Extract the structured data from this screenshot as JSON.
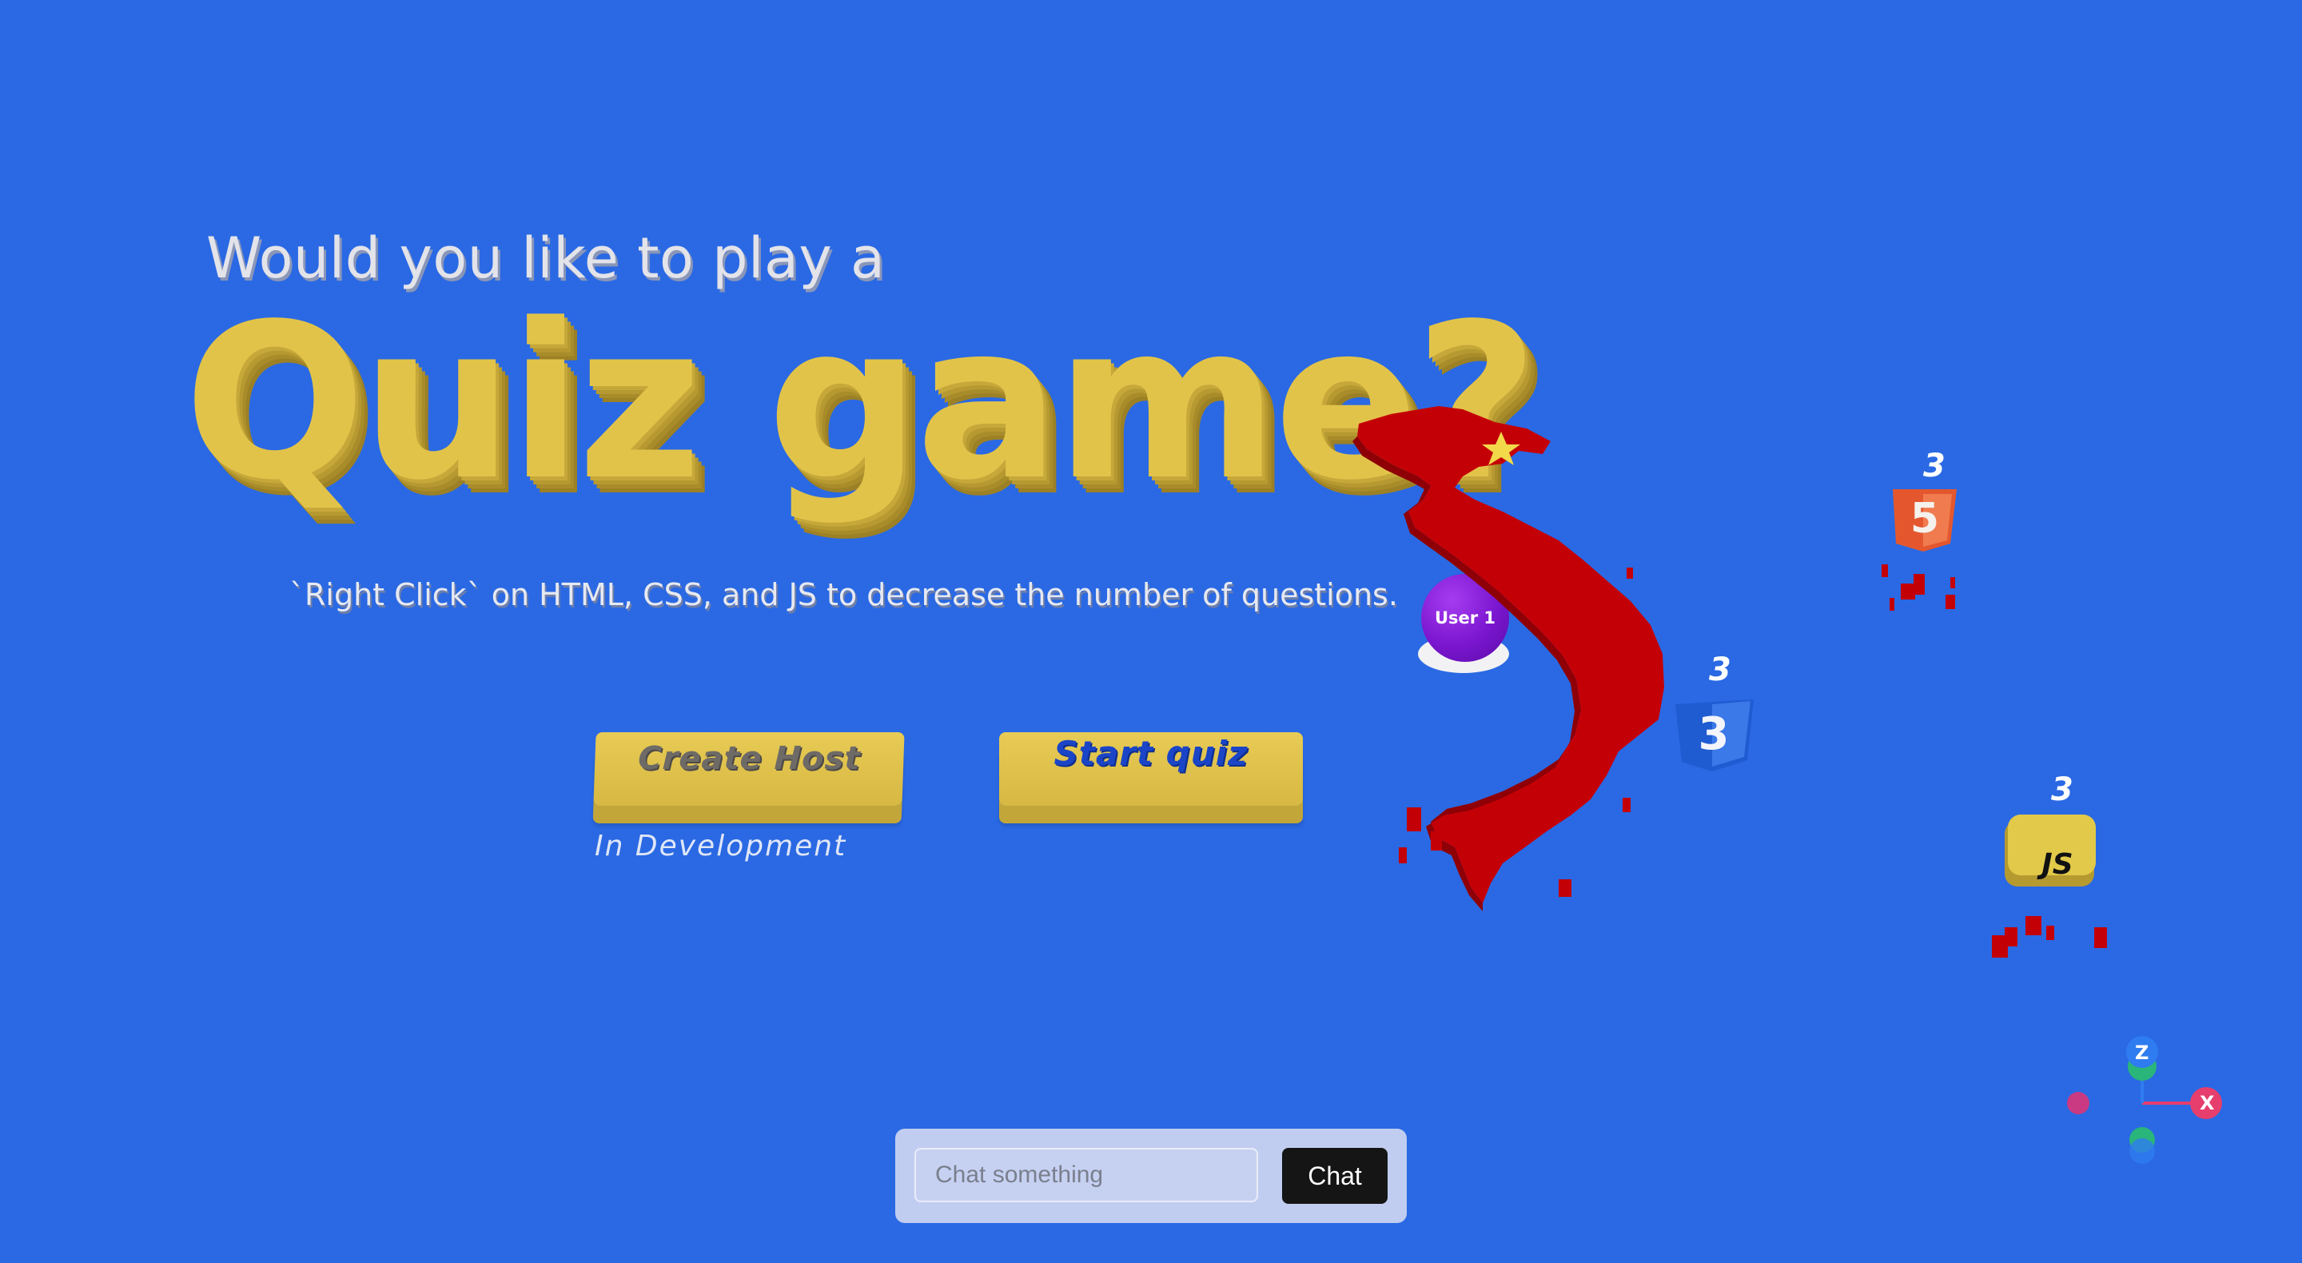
{
  "hero": {
    "question": "Would you like to play a",
    "title": "Quiz game?",
    "hint": "`Right Click` on HTML, CSS, and JS to decrease the number of questions."
  },
  "buttons": {
    "create_host": "Create Host",
    "create_host_note": "In Development",
    "start_quiz": "Start quiz"
  },
  "player": {
    "label": "User 1",
    "color": "#7a16cf"
  },
  "topics": [
    {
      "name": "HTML",
      "icon": "html5-icon",
      "count": "3",
      "color": "#e4572e"
    },
    {
      "name": "CSS",
      "icon": "css3-icon",
      "count": "3",
      "color": "#1f5bd1"
    },
    {
      "name": "JS",
      "icon": "js-icon",
      "count": "3",
      "color": "#e2c94a"
    }
  ],
  "map": {
    "icon": "vietnam-map-icon",
    "color": "#c40007",
    "star_color": "#f2d94a"
  },
  "gizmo": {
    "x_label": "X",
    "z_label": "Z"
  },
  "chat": {
    "placeholder": "Chat something",
    "button": "Chat"
  },
  "colors": {
    "background": "#2a69e3",
    "accent": "#e2c34a"
  }
}
